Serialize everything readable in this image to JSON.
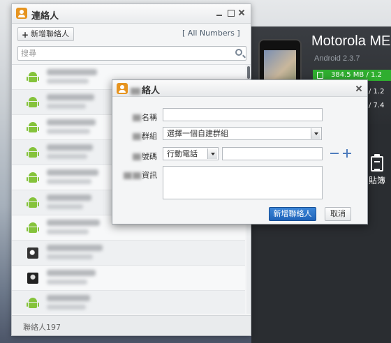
{
  "background": {
    "device_name": "Motorola ME",
    "device_os": "Android 2.3.7",
    "storage_1": "384.5 MB / 1.2",
    "storage_2": "/ 1.2",
    "storage_3": "/ 7.4",
    "clipboard_label": "貼簿"
  },
  "contacts_window": {
    "title": "連絡人",
    "add_button": "新增聯絡人",
    "filter_label": "[ All Numbers ]",
    "search_placeholder": "搜尋",
    "contacts": [
      {
        "avatar": "android-icon"
      },
      {
        "avatar": "android-icon"
      },
      {
        "avatar": "android-icon"
      },
      {
        "avatar": "android-icon"
      },
      {
        "avatar": "android-icon"
      },
      {
        "avatar": "android-icon"
      },
      {
        "avatar": "android-icon"
      },
      {
        "avatar": "photo"
      },
      {
        "avatar": "photo"
      },
      {
        "avatar": "android-icon"
      }
    ],
    "footer_count": "聯絡人197"
  },
  "dialog": {
    "title": "絡人",
    "name_label": "名稱",
    "group_label": "群組",
    "group_value": "選擇一個自建群組",
    "phone_label": "號碼",
    "phone_type_value": "行動電話",
    "info_label": "資訊",
    "primary_button": "新增聯絡人",
    "cancel_button": "取消"
  },
  "colors": {
    "accent": "#2b73c9",
    "android_green": "#85c33b"
  }
}
